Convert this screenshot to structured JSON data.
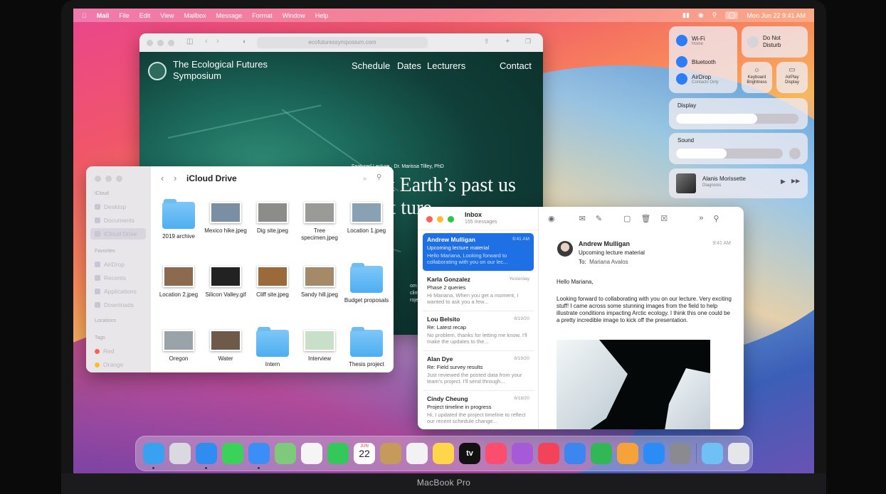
{
  "menubar": {
    "app": "Mail",
    "items": [
      "File",
      "Edit",
      "View",
      "Mailbox",
      "Message",
      "Format",
      "Window",
      "Help"
    ],
    "clock": "Mon Jun 22  9:41 AM"
  },
  "safari": {
    "url": "ecofuturessymposium.com",
    "site_title": "The Ecological Futures Symposium",
    "nav": [
      "Schedule",
      "Dates",
      "Lecturers",
      "Contact"
    ],
    "featured": "Featured Lecture · Dr. Marissa Tilley, PhD",
    "headline": "What Earth’s past us about ture →",
    "side_text": "om EST · at the ... climato ...ance ... roject"
  },
  "finder": {
    "title": "iCloud Drive",
    "sidebar": {
      "sections": [
        "iCloud",
        "Favorites",
        "Locations",
        "Tags"
      ],
      "icloud_items": [
        "Desktop",
        "Documents",
        "iCloud Drive"
      ],
      "favorite_items": [
        "AirDrop",
        "Recents",
        "Applications",
        "Downloads"
      ],
      "tags": [
        {
          "label": "Red",
          "color": "#ff5f57"
        },
        {
          "label": "Orange",
          "color": "#febc2e"
        }
      ]
    },
    "files": [
      {
        "name": "2019 archive",
        "kind": "folder"
      },
      {
        "name": "Mexico hike.jpeg",
        "kind": "image",
        "color": "#7a8fa3"
      },
      {
        "name": "Dig site.jpeg",
        "kind": "image",
        "color": "#8c8c88"
      },
      {
        "name": "Tree specimen.jpeg",
        "kind": "image",
        "color": "#9a9a96"
      },
      {
        "name": "Location 1.jpeg",
        "kind": "image",
        "color": "#8aa0b5"
      },
      {
        "name": "Location 2.jpeg",
        "kind": "image",
        "color": "#8b6a4f"
      },
      {
        "name": "Silicon Valley.gif",
        "kind": "image",
        "color": "#222222"
      },
      {
        "name": "Cliff site.jpeg",
        "kind": "image",
        "color": "#9a6a3a"
      },
      {
        "name": "Sandy hill.jpeg",
        "kind": "image",
        "color": "#a58a6a"
      },
      {
        "name": "Budget proposals",
        "kind": "folder"
      },
      {
        "name": "Oregon",
        "kind": "image",
        "color": "#9aa4a8"
      },
      {
        "name": "Water",
        "kind": "image",
        "color": "#6d5a48"
      },
      {
        "name": "Intern",
        "kind": "folder"
      },
      {
        "name": "Interview",
        "kind": "image",
        "color": "#c8e0c8"
      },
      {
        "name": "Thesis project",
        "kind": "folder"
      }
    ]
  },
  "control_center": {
    "wifi": {
      "label": "Wi-Fi",
      "sub": "Home"
    },
    "bluetooth": {
      "label": "Bluetooth"
    },
    "airdrop": {
      "label": "AirDrop",
      "sub": "Contacts Only"
    },
    "dnd": "Do Not Disturb",
    "keyboard": "Keyboard Brightness",
    "airplay": "AirPlay Display",
    "display": {
      "label": "Display",
      "level": 0.66
    },
    "sound": {
      "label": "Sound",
      "level": 0.47
    },
    "now_playing": {
      "artist": "Alanis Morissette",
      "title": "Diagnosis"
    }
  },
  "mail": {
    "mailbox": "Inbox",
    "count": "155 messages",
    "messages": [
      {
        "from": "Andrew Mulligan",
        "date": "9:41 AM",
        "subject": "Upcoming lecture material",
        "preview": "Hello Mariana, Looking forward to collaborating with you on our lec...",
        "selected": true
      },
      {
        "from": "Karla Gonzalez",
        "date": "Yesterday",
        "subject": "Phase 2 queries",
        "preview": "Hi Mariana, When you get a moment, I wanted to ask you a few...",
        "selected": false
      },
      {
        "from": "Lou Belsito",
        "date": "6/19/20",
        "subject": "Re: Latest recap",
        "preview": "No problem, thanks for letting me know. I'll make the updates to the...",
        "selected": false
      },
      {
        "from": "Alan Dye",
        "date": "6/19/20",
        "subject": "Re: Field survey results",
        "preview": "Just reviewed the posted data from your team's project. I'll send through...",
        "selected": false
      },
      {
        "from": "Cindy Cheung",
        "date": "6/18/20",
        "subject": "Project timeline in progress",
        "preview": "Hi, I updated the project timeline to reflect our recent schedule change...",
        "selected": false
      }
    ],
    "reader": {
      "from": "Andrew Mulligan",
      "subject": "Upcoming lecture material",
      "to_label": "To:",
      "to": "Mariana Avalos",
      "time": "9:41 AM",
      "greeting": "Hello Mariana,",
      "body": "Looking forward to collaborating with you on our lecture. Very exciting stuff! I came across some stunning images from the field to help illustrate conditions impacting Arctic ecology. I think this one could be a pretty incredible image to kick off the presentation."
    }
  },
  "dock": {
    "apps": [
      {
        "name": "finder",
        "color": "#3aa0f0"
      },
      {
        "name": "launchpad",
        "color": "#d9d9e0"
      },
      {
        "name": "safari",
        "color": "#2f8cf0"
      },
      {
        "name": "messages",
        "color": "#3bd25a"
      },
      {
        "name": "mail",
        "color": "#3a8ef6"
      },
      {
        "name": "maps",
        "color": "#7fc97a"
      },
      {
        "name": "photos",
        "color": "#f5f5f5"
      },
      {
        "name": "facetime",
        "color": "#34c759"
      },
      {
        "name": "calendar",
        "color": "#ffffff"
      },
      {
        "name": "contacts",
        "color": "#c69a5a"
      },
      {
        "name": "reminders",
        "color": "#f2f2f4"
      },
      {
        "name": "notes",
        "color": "#ffd54a"
      },
      {
        "name": "apple-tv",
        "color": "#111111"
      },
      {
        "name": "music",
        "color": "#fb4d6e"
      },
      {
        "name": "podcasts",
        "color": "#a65ad8"
      },
      {
        "name": "news",
        "color": "#f3435a"
      },
      {
        "name": "keynote",
        "color": "#3b86ef"
      },
      {
        "name": "numbers",
        "color": "#33b655"
      },
      {
        "name": "pages",
        "color": "#f6a23a"
      },
      {
        "name": "app-store",
        "color": "#2b8cf5"
      },
      {
        "name": "system-preferences",
        "color": "#8a8a90"
      },
      {
        "name": "downloads-folder",
        "color": "#6fc0f5"
      },
      {
        "name": "trash",
        "color": "#e6e6ea"
      }
    ],
    "calendar_month": "JUN",
    "calendar_day": "22",
    "tv_label": "tv"
  },
  "device": {
    "label": "MacBook Pro"
  }
}
